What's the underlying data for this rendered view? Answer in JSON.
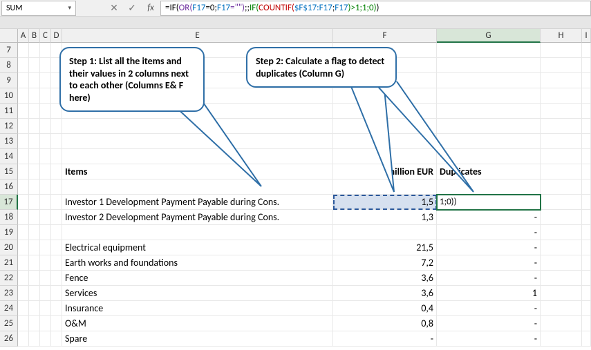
{
  "namebox": "SUM",
  "formula_parts": {
    "p1": "=IF(",
    "p2": "OR(",
    "p3": "F17",
    "p4": "=0;",
    "p5": "F17",
    "p6": "=\"\")",
    "p7": ";;",
    "p8": "IF(",
    "p9": "COUNTIF(",
    "p10": "$F$17:F17",
    "p11": ";",
    "p12": "F17",
    "p13": ")>1;1;0)",
    "p14": ")"
  },
  "fx_label": "fx",
  "columns": {
    "A": "A",
    "B": "B",
    "C": "C",
    "D": "D",
    "E": "E",
    "F": "F",
    "G": "G",
    "H": "H",
    "I": "I"
  },
  "rows": [
    "7",
    "8",
    "9",
    "10",
    "11",
    "12",
    "13",
    "14",
    "15",
    "16",
    "17",
    "18",
    "19",
    "20",
    "21",
    "22",
    "23",
    "24",
    "25",
    "26"
  ],
  "headers": {
    "items": "Items",
    "millionEUR": "million EUR",
    "duplicates": "Duplicates"
  },
  "data_rows": [
    {
      "item": "Investor 1 Development Payment Payable during Cons.",
      "val": "1,5",
      "dup": "1;0))"
    },
    {
      "item": "Investor 2 Development Payment Payable during Cons.",
      "val": "1,3",
      "dup": "-"
    },
    {
      "item": "",
      "val": "",
      "dup": "-"
    },
    {
      "item": "Electrical equipment",
      "val": "21,5",
      "dup": "-"
    },
    {
      "item": "Earth works and foundations",
      "val": "7,2",
      "dup": "-"
    },
    {
      "item": "Fence",
      "val": "3,6",
      "dup": "-"
    },
    {
      "item": "Services",
      "val": "3,6",
      "dup": "1"
    },
    {
      "item": "Insurance",
      "val": "0,4",
      "dup": "-"
    },
    {
      "item": "O&M",
      "val": "0,8",
      "dup": "-"
    },
    {
      "item": "Spare",
      "val": "-",
      "dup": "-"
    }
  ],
  "callouts": {
    "c1": "Step 1: List all the items and their values in 2 columns next to each other (Columns E& F here)",
    "c2": "Step 2: Calculate a flag to detect duplicates (Column G)"
  },
  "icons": {
    "dropdown": "▾",
    "cancel": "✕",
    "enter": "✓"
  }
}
